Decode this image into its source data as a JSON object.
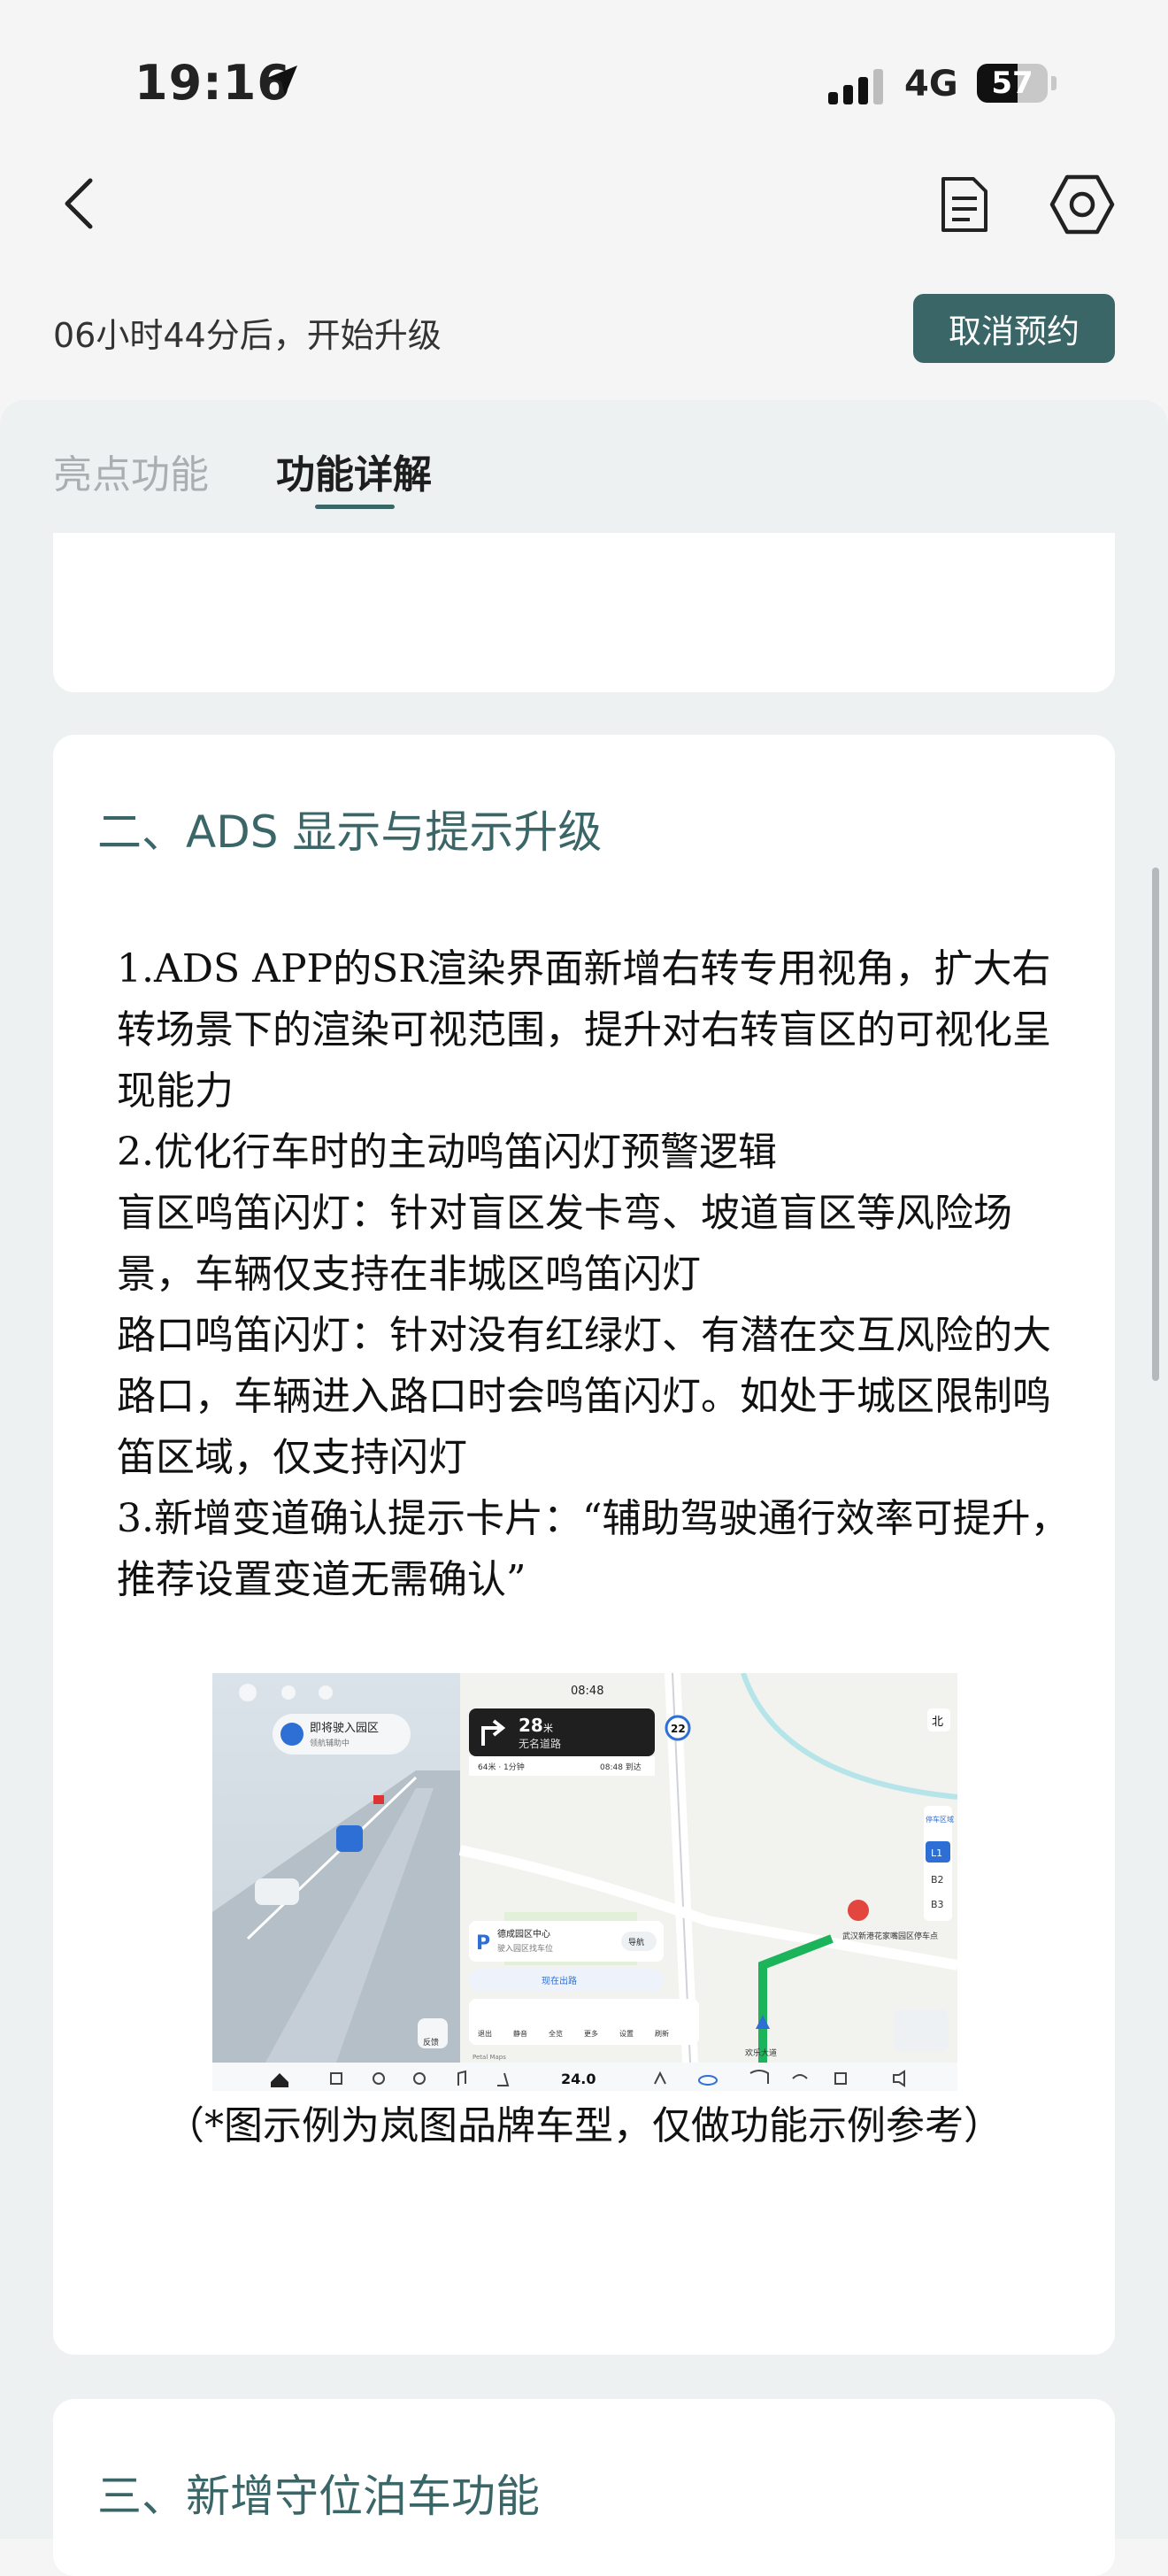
{
  "status": {
    "time": "19:16",
    "network": "4G",
    "battery": "57",
    "battery_level": 0.57
  },
  "nav": {
    "back_icon": "chevron-left-icon",
    "doc_icon": "document-icon",
    "settings_icon": "hexagon-gear-icon"
  },
  "schedule": {
    "countdown": "06小时44分后，开始升级",
    "cancel_label": "取消预约"
  },
  "tabs": [
    {
      "label": "亮点功能",
      "active": false
    },
    {
      "label": "功能详解",
      "active": true
    }
  ],
  "section_ads": {
    "title": "二、ADS 显示与提示升级",
    "body": "1.ADS APP的SR渲染界面新增右转专用视角，扩大右转场景下的渲染可视范围，提升对右转盲区的可视化呈现能力\n2.优化行车时的主动鸣笛闪灯预警逻辑\n盲区鸣笛闪灯：针对盲区发卡弯、坡道盲区等风险场景，车辆仅支持在非城区鸣笛闪灯\n路口鸣笛闪灯：针对没有红绿灯、有潜在交互风险的大路口，车辆进入路口时会鸣笛闪灯。如处于城区限制鸣笛区域，仅支持闪灯\n3.新增变道确认提示卡片：“辅助驾驶通行效率可提升，推荐设置变道无需确认”",
    "caption": "（*图示例为岚图品牌车型，仅做功能示例参考）"
  },
  "illustration": {
    "left_banner": "即将驶入园区",
    "left_banner_sub": "领航辅助中",
    "map_time": "08:48",
    "turn_distance": "28",
    "turn_unit": "米",
    "road_name": "无名道路",
    "route_info": "64米 · 1分钟",
    "arrive_time": "08:48 到达",
    "speed_limit": "22",
    "north_label": "北",
    "floors": [
      "L1",
      "B2",
      "B3"
    ],
    "parking_title": "停车区域",
    "parking_card_title": "德成园区中心",
    "parking_card_sub": "驶入园区找车位",
    "parking_card_btn": "导航",
    "start_route_btn": "现在出路",
    "bottom_road": "欢乐大道",
    "poi_label": "武汉新港花家嘴园区停车点",
    "temperature": "24.0",
    "dock_labels": [
      "退出",
      "静音",
      "全览",
      "更多",
      "设置",
      "刷新"
    ],
    "feedback_label": "反馈",
    "petal_label": "Petal Maps"
  },
  "section_next": {
    "title": "三、新增守位泊车功能"
  }
}
